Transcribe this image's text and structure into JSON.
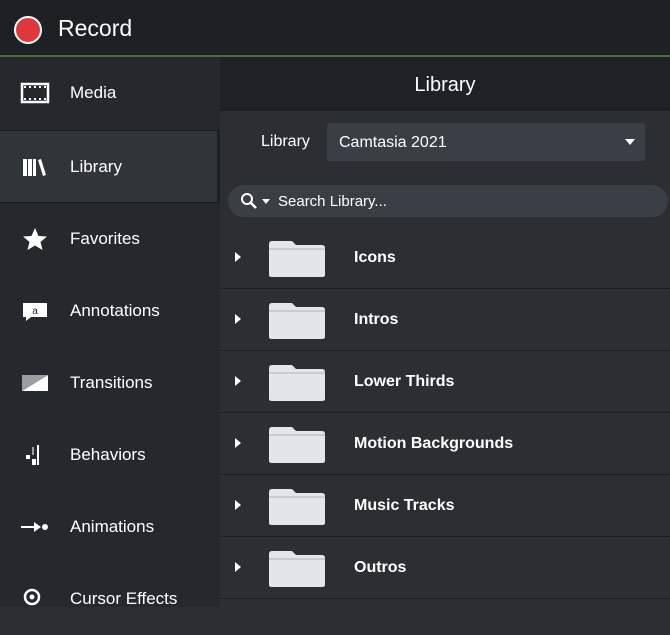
{
  "record": {
    "label": "Record"
  },
  "sidebar": {
    "items": [
      {
        "label": "Media",
        "icon": "film-icon"
      },
      {
        "label": "Library",
        "icon": "books-icon"
      },
      {
        "label": "Favorites",
        "icon": "star-icon"
      },
      {
        "label": "Annotations",
        "icon": "callout-icon"
      },
      {
        "label": "Transitions",
        "icon": "transition-icon"
      },
      {
        "label": "Behaviors",
        "icon": "behaviors-icon"
      },
      {
        "label": "Animations",
        "icon": "arrow-animation-icon"
      },
      {
        "label": "Cursor Effects",
        "icon": "cursor-icon"
      }
    ]
  },
  "main": {
    "title": "Library",
    "library_label": "Library",
    "library_selected": "Camtasia 2021",
    "search_placeholder": "Search Library...",
    "folders": [
      {
        "name": "Icons"
      },
      {
        "name": "Intros"
      },
      {
        "name": "Lower Thirds"
      },
      {
        "name": "Motion Backgrounds"
      },
      {
        "name": "Music Tracks"
      },
      {
        "name": "Outros"
      }
    ]
  },
  "colors": {
    "record_red": "#e0373d",
    "accent_green": "#4f6b3a",
    "folder": "#e3e5e8"
  }
}
